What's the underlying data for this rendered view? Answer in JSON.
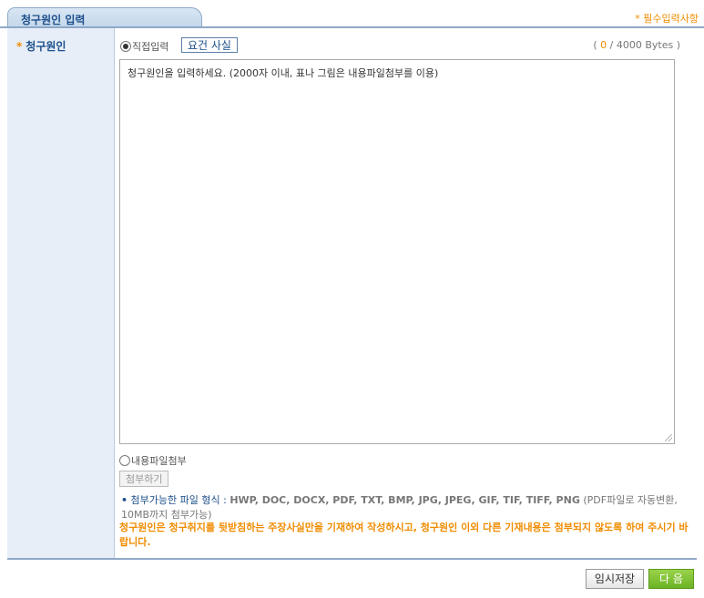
{
  "tab": {
    "title": "청구원인 입력"
  },
  "required_note": "* 필수입력사항",
  "field": {
    "star": "*",
    "label": "청구원인"
  },
  "direct_input": {
    "label": "직접입력",
    "selected": true
  },
  "essentials_button": "요건 사실",
  "byte_counter": {
    "open": "( ",
    "current": "0",
    "sep": " / ",
    "max": "4000 Bytes )"
  },
  "textarea": {
    "placeholder": "청구원인을 입력하세요. (2000자 이내, 표나 그림은 내용파일첨부를 이용)"
  },
  "file_attach": {
    "label": "내용파일첨부",
    "selected": false
  },
  "attach_button": "첨부하기",
  "format_note": {
    "bullet": "•",
    "label": "첨부가능한 파일 형식 : ",
    "types": "HWP, DOC, DOCX, PDF, TXT, BMP, JPG, JPEG, GIF, TIF, TIFF, PNG",
    "suffix": " (PDF파일로 자동변환, 10MB까지 첨부가능)"
  },
  "warning": "청구원인은 청구취지를 뒷받침하는 주장사실만을 기재하여 작성하시고, 청구원인 이외 다른 기재내용은 첨부되지 않도록 하여 주시기 바랍니다.",
  "buttons": {
    "save": "임시저장",
    "next": "다 음"
  },
  "colors": {
    "accent": "#1d4f8a",
    "warning": "#f08c00",
    "next": "#6bb324",
    "tab_border": "#8fa8c8"
  }
}
